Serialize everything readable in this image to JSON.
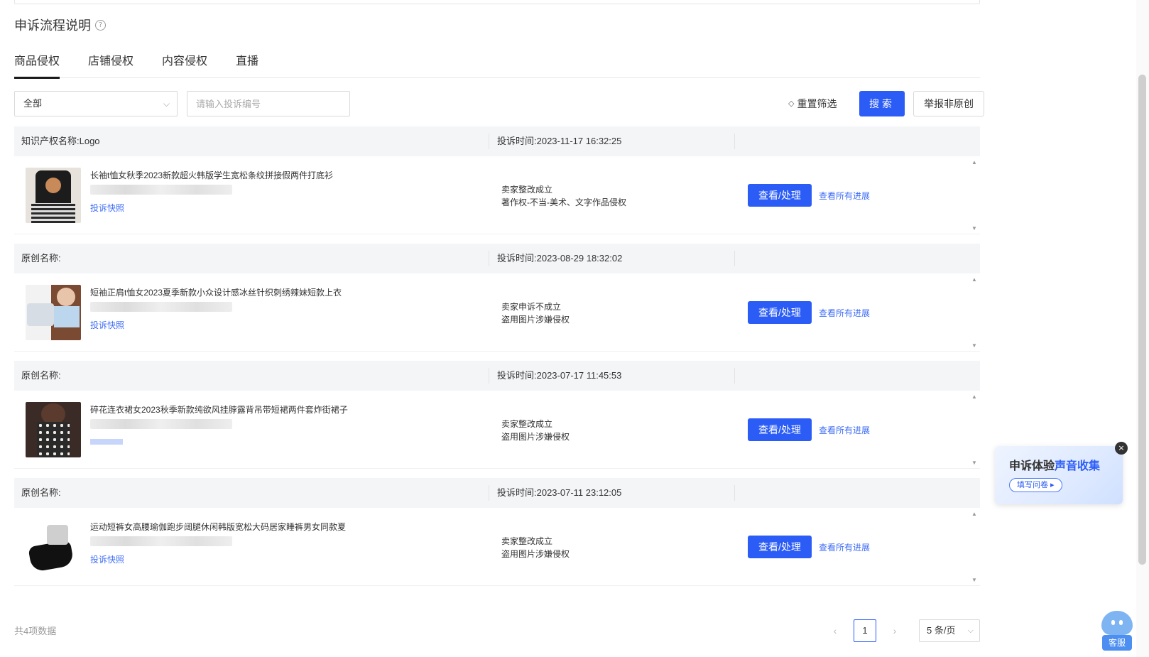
{
  "page": {
    "title": "申诉流程说明",
    "help_icon": "?"
  },
  "tabs": [
    {
      "label": "商品侵权",
      "active": true
    },
    {
      "label": "店铺侵权",
      "active": false
    },
    {
      "label": "内容侵权",
      "active": false
    },
    {
      "label": "直播",
      "active": false
    }
  ],
  "filters": {
    "select_value": "全部",
    "select_chevron": "⌵",
    "search_placeholder": "请输入投诉编号",
    "reset_label": "重置筛选",
    "reset_icon": "◇",
    "search_label": "搜索",
    "report_label": "举报非原创"
  },
  "records": [
    {
      "name": "知识产权名称:Logo",
      "time": "投诉时间:2023-11-17 16:32:25",
      "product_title": "长袖t恤女秋季2023新款超火韩版学生宽松条纹拼接假两件打底衫",
      "snapshot": "投诉快照",
      "status_line1": "卖家整改成立",
      "status_line2": "著作权-不当-美术、文字作品侵权",
      "view_label": "查看/处理",
      "progress_label": "查看所有进展"
    },
    {
      "name": "原创名称:",
      "time": "投诉时间:2023-08-29 18:32:02",
      "product_title": "短袖正肩t恤女2023夏季新款小众设计感冰丝针织刺绣辣妹短款上衣",
      "snapshot": "投诉快照",
      "status_line1": "卖家申诉不成立",
      "status_line2": "盗用图片涉嫌侵权",
      "view_label": "查看/处理",
      "progress_label": "查看所有进展"
    },
    {
      "name": "原创名称:",
      "time": "投诉时间:2023-07-17 11:45:53",
      "product_title": "碎花连衣裙女2023秋季新款纯欲风挂脖露背吊带短裙两件套炸街裙子",
      "snapshot": "",
      "status_line1": "卖家整改成立",
      "status_line2": "盗用图片涉嫌侵权",
      "view_label": "查看/处理",
      "progress_label": "查看所有进展"
    },
    {
      "name": "原创名称:",
      "time": "投诉时间:2023-07-11 23:12:05",
      "product_title": "运动短裤女高腰瑜伽跑步阔腿休闲韩版宽松大码居家睡裤男女同款夏",
      "snapshot": "投诉快照",
      "status_line1": "卖家整改成立",
      "status_line2": "盗用图片涉嫌侵权",
      "view_label": "查看/处理",
      "progress_label": "查看所有进展"
    }
  ],
  "footer": {
    "total": "共4项数据",
    "prev": "‹",
    "current_page": "1",
    "next": "›",
    "page_size": "5 条/页"
  },
  "feedback": {
    "title_part1": "申诉体验",
    "title_part2": "声音收集",
    "button": "填写问卷 ▸",
    "close": "×"
  },
  "support": {
    "label": "客服"
  },
  "colors": {
    "primary": "#2b5cf6",
    "link": "#3d6cf5",
    "header_bg": "#f4f5f7"
  }
}
